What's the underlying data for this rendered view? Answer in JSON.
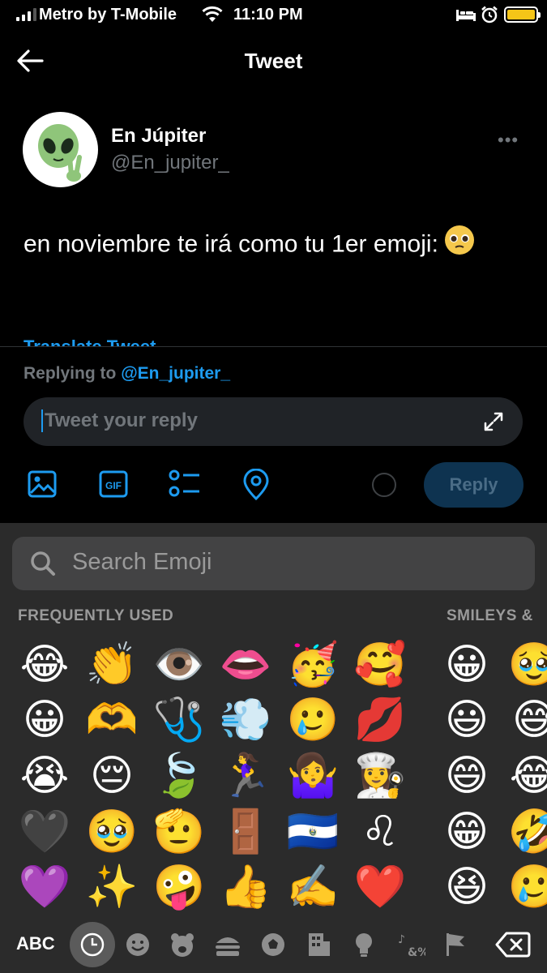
{
  "status_bar": {
    "carrier": "Metro by T-Mobile",
    "time": "11:10 PM",
    "battery_level": 1.0
  },
  "nav": {
    "title": "Tweet",
    "back_icon": "back-arrow-icon"
  },
  "tweet": {
    "author_name": "En Júpiter",
    "author_handle": "@En_jupiter_",
    "avatar_icon": "alien-peace-icon",
    "text": "en noviembre te irá como tu 1er emoji:",
    "text_emoji": "🥹",
    "translate_label": "Translate Tweet",
    "more_icon": "more-dots-icon"
  },
  "reply": {
    "replying_prefix": "Replying to",
    "replying_to": "@En_jupiter_",
    "placeholder": "Tweet your reply",
    "button_label": "Reply",
    "toolbar_icons": [
      "image-icon",
      "gif-icon",
      "poll-icon",
      "location-icon"
    ]
  },
  "emoji_keyboard": {
    "search_placeholder": "Search Emoji",
    "section_frequent": "FREQUENTLY USED",
    "section_smileys": "SMILEYS &",
    "frequent_columns": [
      [
        "😂",
        "😀",
        "😭",
        "🖤",
        "💜"
      ],
      [
        "👏",
        "🫶",
        "😔",
        "🥹",
        "✨"
      ],
      [
        "👁️",
        "🩺",
        "🍃",
        "🫡",
        "🤪"
      ],
      [
        "👄",
        "💨",
        "🏃‍♀️",
        "🚪",
        "👍"
      ],
      [
        "🥳",
        "🥲",
        "🤷‍♀️",
        "🇸🇻",
        "✍️"
      ],
      [
        "🥰",
        "💋",
        "👩‍🍳",
        "♌",
        "❤️"
      ]
    ],
    "smileys_columns": [
      [
        "😀",
        "😃",
        "😄",
        "😁",
        "😆"
      ],
      [
        "🥹",
        "😅",
        "😂",
        "🤣",
        "🥲"
      ]
    ],
    "abc_label": "ABC",
    "category_icons": [
      "recent-clock-icon",
      "smiley-icon",
      "animal-bear-icon",
      "food-icon",
      "activity-ball-icon",
      "travel-building-icon",
      "objects-bulb-icon",
      "symbols-icon",
      "flag-icon"
    ],
    "delete_icon": "backspace-icon"
  }
}
